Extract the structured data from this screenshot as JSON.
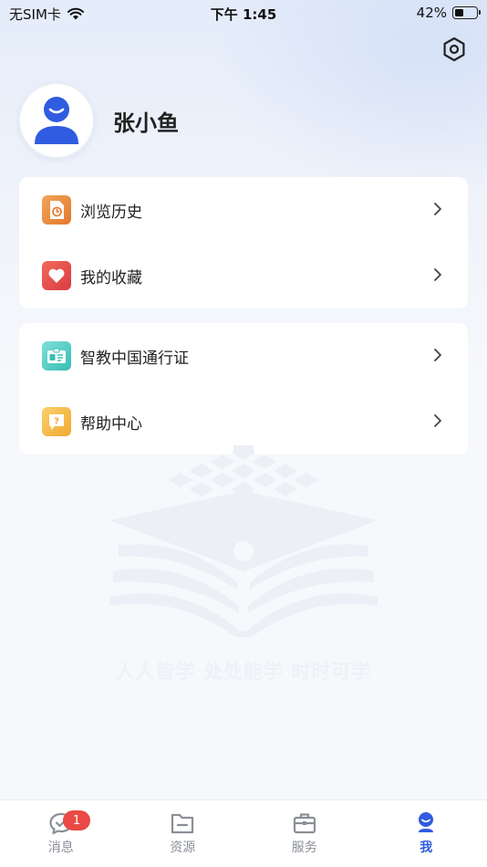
{
  "status_bar": {
    "carrier": "无SIM卡",
    "time": "下午 1:45",
    "battery_percent": "42%",
    "battery_level": 0.42
  },
  "header": {
    "settings_icon": "settings-hexagon-icon"
  },
  "profile": {
    "username": "张小鱼",
    "avatar_icon": "user-avatar-icon"
  },
  "menu_group_1": [
    {
      "label": "浏览历史",
      "icon": "history-icon",
      "color": "#ee8a3c"
    },
    {
      "label": "我的收藏",
      "icon": "heart-icon",
      "color": "#e8474a"
    }
  ],
  "menu_group_2": [
    {
      "label": "智教中国通行证",
      "icon": "id-card-icon",
      "color": "#3cc6c0"
    },
    {
      "label": "帮助中心",
      "icon": "help-icon",
      "color": "#f4b43c"
    }
  ],
  "watermark": {
    "slogan": "人人皆学 处处能学 时时可学"
  },
  "tab_bar": {
    "tabs": [
      {
        "label": "消息",
        "icon": "message-icon",
        "badge": "1",
        "active": false
      },
      {
        "label": "资源",
        "icon": "folder-icon",
        "active": false
      },
      {
        "label": "服务",
        "icon": "briefcase-icon",
        "active": false
      },
      {
        "label": "我",
        "icon": "me-icon",
        "active": true
      }
    ]
  },
  "colors": {
    "accent": "#2f5ce0",
    "badge": "#e94a45",
    "page_background": "#f6f8fb"
  }
}
